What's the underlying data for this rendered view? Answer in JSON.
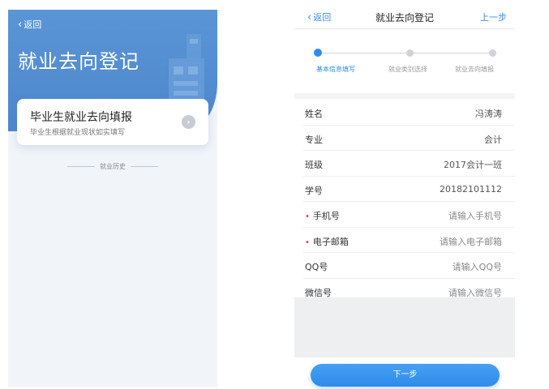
{
  "left": {
    "back_label": "返回",
    "title": "就业去向登记",
    "card": {
      "title": "毕业生就业去向填报",
      "subtitle": "毕业生根据就业现状如实填写"
    },
    "history_label": "就业历史"
  },
  "right": {
    "nav": {
      "back_label": "返回",
      "title": "就业去向登记",
      "prev_label": "上一步"
    },
    "steps": [
      {
        "label": "基本信息填写",
        "active": true
      },
      {
        "label": "就业类别选择",
        "active": false
      },
      {
        "label": "就业去向填报",
        "active": false
      }
    ],
    "form": {
      "rows": [
        {
          "label": "姓名",
          "value": "冯涛涛",
          "required": false
        },
        {
          "label": "专业",
          "value": "会计",
          "required": false
        },
        {
          "label": "班级",
          "value": "2017会计一班",
          "required": false
        },
        {
          "label": "学号",
          "value": "20182101112",
          "required": false
        },
        {
          "label": "手机号",
          "placeholder": "请输入手机号",
          "required": true
        },
        {
          "label": "电子邮箱",
          "placeholder": "请输入电子邮箱",
          "required": true
        },
        {
          "label": "QQ号",
          "placeholder": "请输入QQ号",
          "required": false
        },
        {
          "label": "微信号",
          "placeholder": "请输入微信号",
          "required": false
        }
      ]
    },
    "next_label": "下一步"
  },
  "colors": {
    "accent": "#2d8cf0",
    "hero": "#4d87cc",
    "required": "#e53935"
  },
  "icons": {
    "back": "chevron-left-icon",
    "card_arrow": "chevron-right-icon"
  }
}
